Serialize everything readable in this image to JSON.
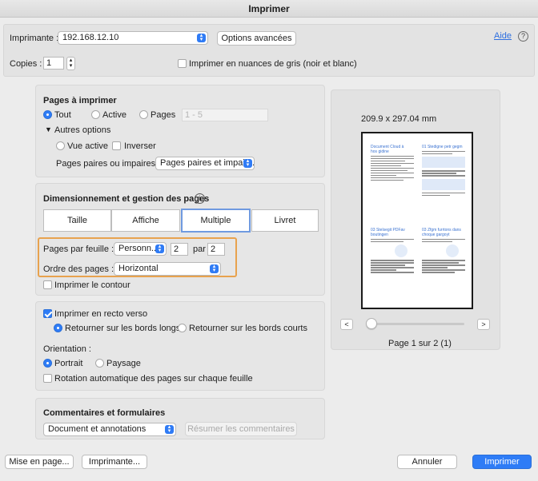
{
  "window": {
    "title": "Imprimer"
  },
  "printer": {
    "label": "Imprimante :",
    "value": "192.168.12.10",
    "advanced_button": "Options avancées",
    "help_link": "Aide",
    "help_icon": "?"
  },
  "copies": {
    "label": "Copies :",
    "value": "1",
    "grayscale_label": "Imprimer en nuances de gris (noir et blanc)",
    "grayscale_checked": false
  },
  "pages": {
    "heading": "Pages à imprimer",
    "all_label": "Tout",
    "active_label": "Active",
    "pages_label": "Pages",
    "pages_placeholder": "1 - 5",
    "more_options_label": "Autres options",
    "active_view_label": "Vue active",
    "reverse_label": "Inverser",
    "odd_even_label": "Pages paires ou impaires :",
    "odd_even_value": "Pages paires et impair..."
  },
  "sizing": {
    "heading": "Dimensionnement et gestion des pages",
    "info_icon": "i",
    "tabs": [
      "Taille",
      "Affiche",
      "Multiple",
      "Livret"
    ],
    "selected_tab": "Multiple",
    "pages_per_sheet_label": "Pages par feuille :",
    "pages_per_sheet_value": "Personn...",
    "cols_value": "2",
    "by_label": "par",
    "rows_value": "2",
    "page_order_label": "Ordre des pages :",
    "page_order_value": "Horizontal",
    "print_border_label": "Imprimer le contour"
  },
  "duplex": {
    "label": "Imprimer en recto verso",
    "checked": true,
    "long_edge_label": "Retourner sur les bords longs",
    "short_edge_label": "Retourner sur les bords courts",
    "orientation_label": "Orientation :",
    "portrait_label": "Portrait",
    "landscape_label": "Paysage",
    "auto_rotate_label": "Rotation automatique des pages sur chaque feuille"
  },
  "comments": {
    "heading": "Commentaires et formulaires",
    "value": "Document et annotations",
    "summarize_button": "Résumer les commentaires"
  },
  "preview": {
    "size_label": "209.9 x 297.04 mm",
    "page_indicator": "Page 1 sur 2 (1)",
    "prev": "<",
    "next": ">",
    "thumb_titles": [
      "Document Cloud à\nhos gidine",
      "01 Stedigne petr gegm",
      "03 Stelsegit PDFav\nboutingen",
      "03 Zfgm furrtons dans\nchoque gargoyt"
    ]
  },
  "footer": {
    "page_setup": "Mise en page...",
    "printer_button": "Imprimante...",
    "cancel": "Annuler",
    "print": "Imprimer"
  },
  "colors": {
    "accent": "#2e7cf6",
    "highlight": "#e8a24e"
  }
}
